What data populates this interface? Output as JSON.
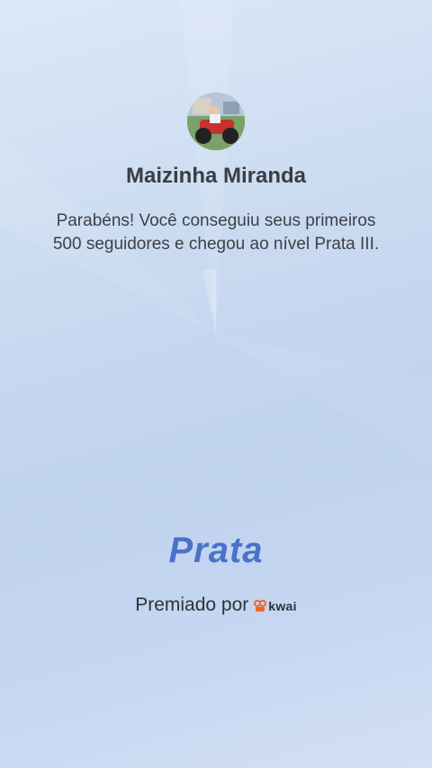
{
  "user": {
    "name": "Maizinha Miranda"
  },
  "message": "Parabéns! Você conseguiu seus primeiros 500 seguidores e chegou ao nível Prata III.",
  "badge": {
    "level": "Prata"
  },
  "footer": {
    "awarded_by": "Premiado por",
    "brand": "kwai",
    "brand_color": "#f2662b"
  },
  "colors": {
    "level_text": "#4a72c9",
    "background": "#c9daf0"
  }
}
